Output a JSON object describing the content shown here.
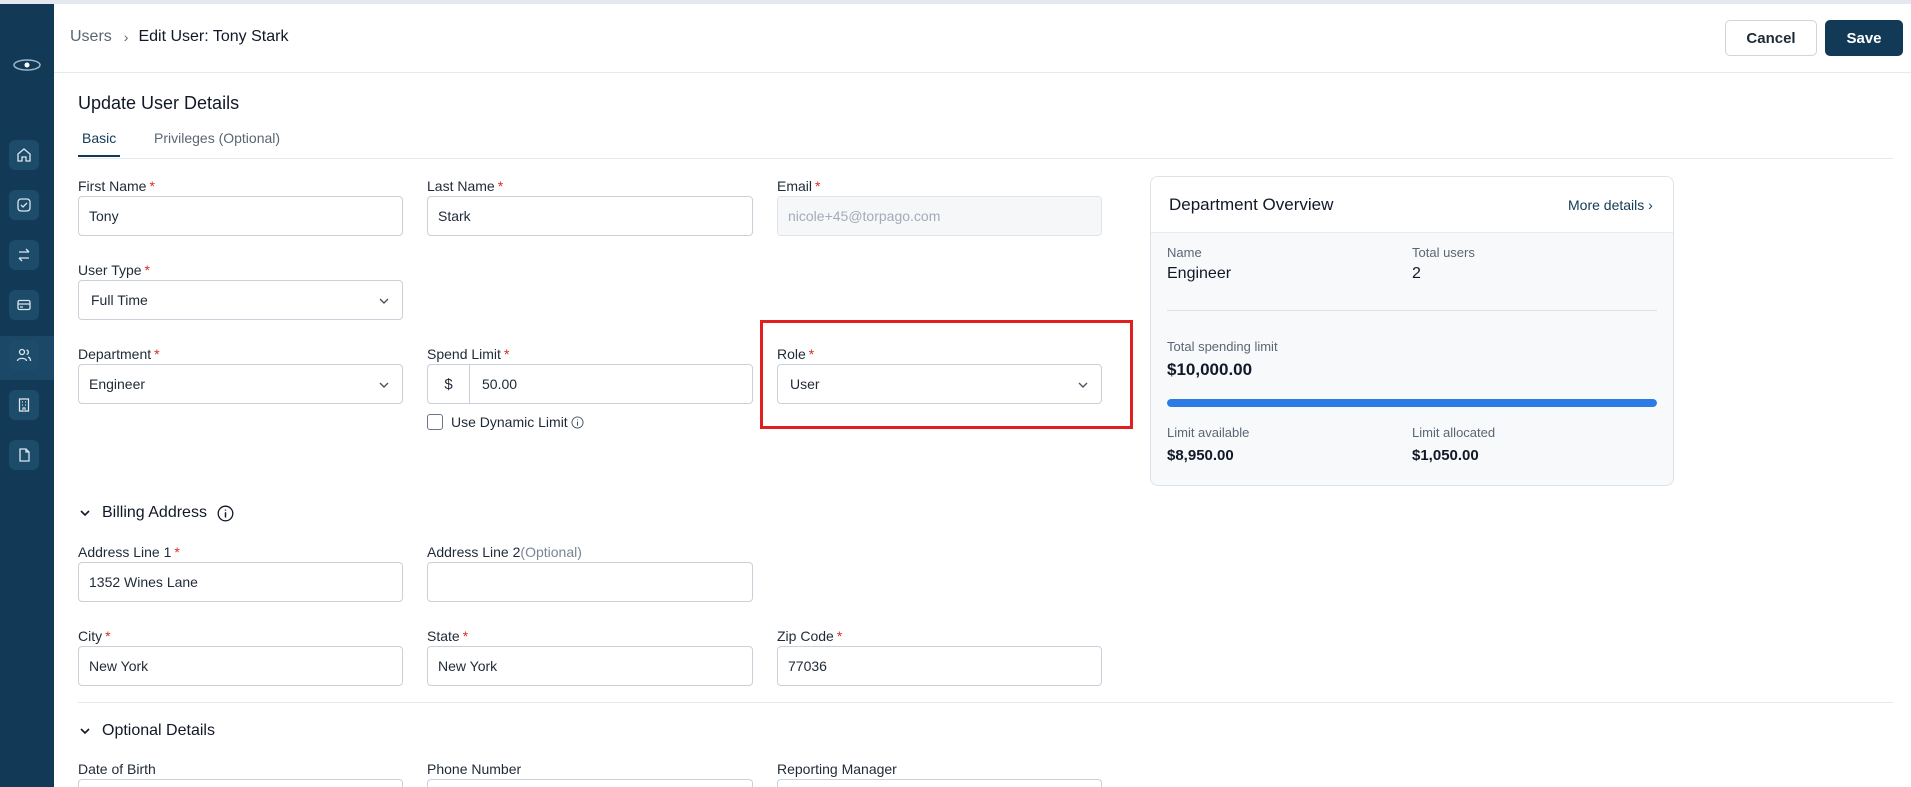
{
  "breadcrumb": {
    "parent": "Users",
    "current": "Edit User: Tony Stark"
  },
  "actions": {
    "cancel": "Cancel",
    "save": "Save"
  },
  "page_title": "Update User Details",
  "tabs": [
    {
      "label": "Basic",
      "active": true
    },
    {
      "label": "Privileges (Optional)",
      "active": false
    }
  ],
  "form": {
    "first_name": {
      "label": "First Name",
      "value": "Tony"
    },
    "last_name": {
      "label": "Last Name",
      "value": "Stark"
    },
    "email": {
      "label": "Email",
      "value": "nicole+45@torpago.com"
    },
    "user_type": {
      "label": "User Type",
      "value": "Full Time"
    },
    "department": {
      "label": "Department",
      "value": "Engineer"
    },
    "spend_limit": {
      "label": "Spend Limit",
      "currency": "$",
      "value": "50.00"
    },
    "dynamic_limit": {
      "label": "Use Dynamic Limit",
      "checked": false
    },
    "role": {
      "label": "Role",
      "value": "User"
    }
  },
  "billing": {
    "title": "Billing Address",
    "address1": {
      "label": "Address Line 1",
      "value": "1352 Wines Lane"
    },
    "address2": {
      "label": "Address Line 2",
      "optional": "(Optional)",
      "value": ""
    },
    "city": {
      "label": "City",
      "value": "New York"
    },
    "state": {
      "label": "State",
      "value": "New York"
    },
    "zip": {
      "label": "Zip Code",
      "value": "77036"
    }
  },
  "optional": {
    "title": "Optional Details",
    "dob": {
      "label": "Date of Birth"
    },
    "phone": {
      "label": "Phone Number"
    },
    "manager": {
      "label": "Reporting Manager"
    }
  },
  "overview": {
    "title": "Department Overview",
    "more_link": "More details",
    "name_label": "Name",
    "name_value": "Engineer",
    "users_label": "Total users",
    "users_value": "2",
    "total_label": "Total spending limit",
    "total_value": "$10,000.00",
    "progress_fraction": 1.0,
    "available_label": "Limit available",
    "available_value": "$8,950.00",
    "allocated_label": "Limit allocated",
    "allocated_value": "$1,050.00"
  },
  "colors": {
    "sidebar": "#123a56",
    "primary": "#123a56",
    "required": "#d92d20",
    "progress": "#2d7be5",
    "highlight": "#e0201f"
  }
}
